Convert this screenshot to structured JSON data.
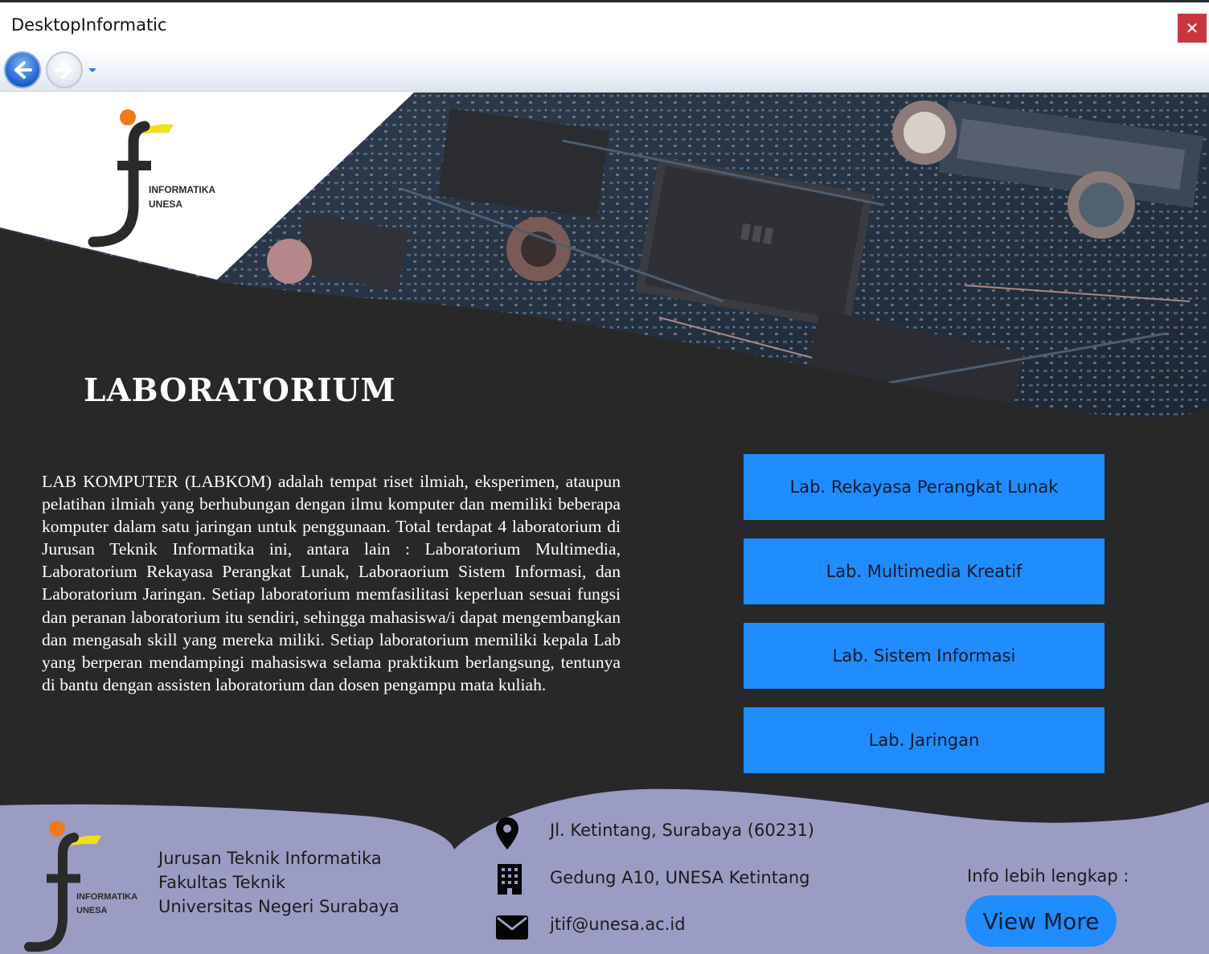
{
  "window": {
    "title": "DesktopInformatic",
    "close_glyph": "✕"
  },
  "nav": {
    "back_icon": "back-arrow-icon",
    "forward_icon": "forward-arrow-icon",
    "history_icon": "dropdown-arrow-icon"
  },
  "logo": {
    "line1": "INFORMATIKA",
    "line2": "UNESA"
  },
  "heading": "LABORATORIUM",
  "description": "LAB KOMPUTER (LABKOM) adalah tempat riset ilmiah, eksperimen, ataupun pelatihan ilmiah yang berhubungan dengan ilmu komputer dan memiliki beberapa komputer dalam satu jaringan untuk penggunaan. Total terdapat 4 laboratorium di Jurusan Teknik Informatika ini, antara lain : Laboratorium Multimedia, Laboratorium Rekayasa Perangkat Lunak, Laboraorium Sistem Informasi, dan Laboratorium Jaringan. Setiap laboratorium memfasilitasi keperluan sesuai fungsi dan peranan laboratorium itu sendiri, sehingga mahasiswa/i dapat mengembangkan dan mengasah skill yang mereka miliki. Setiap laboratorium memiliki kepala Lab yang berperan mendampingi mahasiswa selama praktikum berlangsung, tentunya di bantu dengan assisten laboratorium dan dosen pengampu mata kuliah.",
  "labs": [
    {
      "label": "Lab. Rekayasa Perangkat Lunak"
    },
    {
      "label": "Lab. Multimedia Kreatif"
    },
    {
      "label": "Lab. Sistem Informasi"
    },
    {
      "label": "Lab. Jaringan"
    }
  ],
  "footer": {
    "org_lines": [
      "Jurusan Teknik Informatika",
      "Fakultas Teknik",
      "Universitas Negeri Surabaya"
    ],
    "address": "Jl. Ketintang, Surabaya (60231)",
    "building": "Gedung A10, UNESA Ketintang",
    "email": "jtif@unesa.ac.id",
    "info_label": "Info lebih lengkap :",
    "view_more": "View More"
  },
  "colors": {
    "page_bg": "#282829",
    "button_blue": "#1f8cff",
    "footer_bg": "#9b9cc4",
    "close_red": "#c9353f"
  }
}
